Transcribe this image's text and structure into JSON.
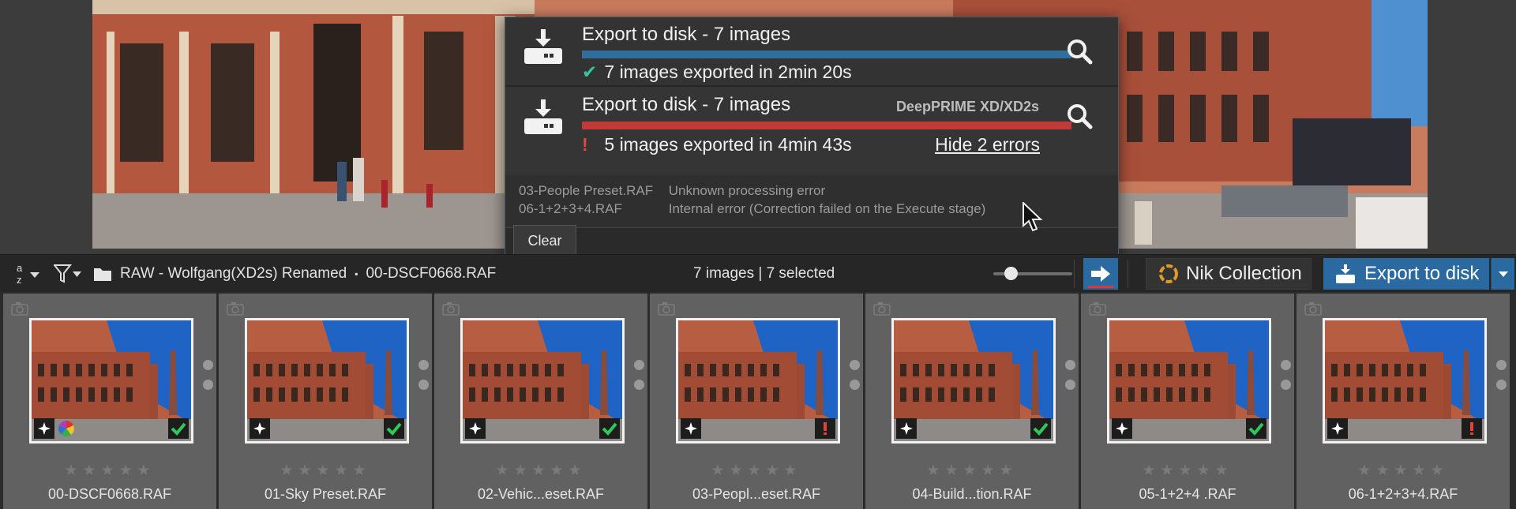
{
  "popup": {
    "jobs": [
      {
        "title": "Export to disk - 7 images",
        "processing": "",
        "progress": 1.0,
        "bar_color": "#2e6f9e",
        "status_glyph": "✔",
        "status_color": "#39c2a0",
        "status_text": "7 images exported in 2min 20s"
      },
      {
        "title": "Export to disk - 7 images",
        "processing": "DeepPRIME XD/XD2s",
        "progress": 1.0,
        "bar_color": "#c23a37",
        "status_glyph": "!",
        "status_color": "#e0493c",
        "status_text": "5 images exported in 4min 43s",
        "hide_errors_label": "Hide 2 errors"
      }
    ],
    "errors": [
      {
        "file": "03-People Preset.RAF",
        "message": "Unknown processing error"
      },
      {
        "file": "06-1+2+3+4.RAF",
        "message": "Internal error (Correction failed on the Execute stage)"
      }
    ],
    "clear_label": "Clear"
  },
  "toolbar": {
    "sort_icon": "sort-az-icon",
    "filter_icon": "filter-icon",
    "folder_icon": "folder-icon",
    "folder": "RAW - Wolfgang(XD2s) Renamed",
    "separator": "▪",
    "current_file": "00-DSCF0668.RAF",
    "selection": "7 images | 7 selected",
    "zoom_level": 0.2,
    "nik_label": "Nik Collection",
    "export_label": "Export to disk",
    "accent_color": "#2b6aa0"
  },
  "filmstrip": {
    "rating_stars": "★★★★★",
    "items": [
      {
        "filename": "00-DSCF0668.RAF",
        "status": "ok",
        "color_badge": true
      },
      {
        "filename": "01-Sky Preset.RAF",
        "status": "ok",
        "color_badge": false
      },
      {
        "filename": "02-Vehic...eset.RAF",
        "status": "ok",
        "color_badge": false
      },
      {
        "filename": "03-Peopl...eset.RAF",
        "status": "error",
        "color_badge": false
      },
      {
        "filename": "04-Build...tion.RAF",
        "status": "ok",
        "color_badge": false
      },
      {
        "filename": "05-1+2+4 .RAF",
        "status": "ok",
        "color_badge": false
      },
      {
        "filename": "06-1+2+3+4.RAF",
        "status": "error",
        "color_badge": false
      }
    ]
  }
}
